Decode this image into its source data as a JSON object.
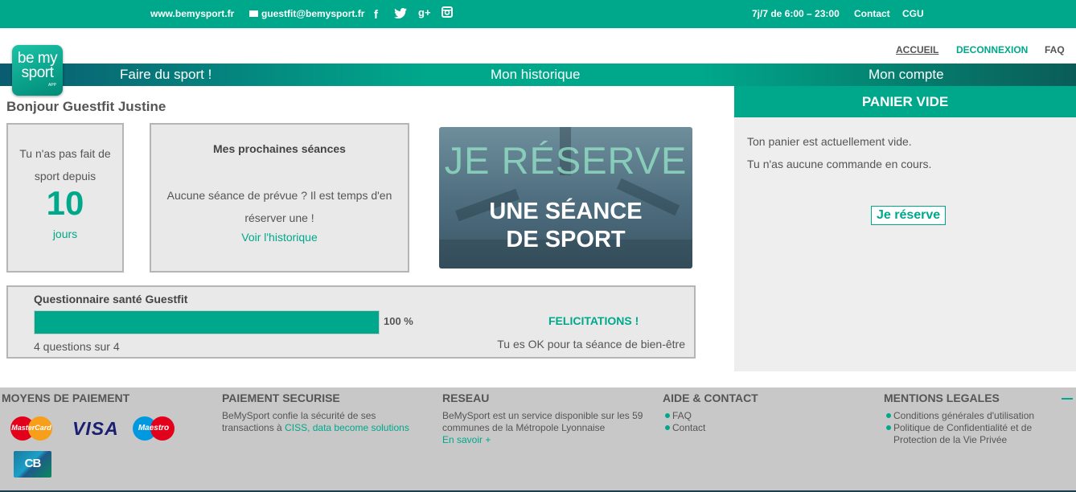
{
  "topbar": {
    "site": "www.bemysport.fr",
    "email": "guestfit@bemysport.fr",
    "social": [
      "f",
      "t",
      "g+",
      "ig"
    ],
    "hours": "7j/7 de 6:00 – 23:00",
    "contact": "Contact",
    "cgu": "CGU"
  },
  "header": {
    "links": [
      "ACCUEIL",
      "DECONNEXION",
      "FAQ"
    ]
  },
  "logo": {
    "line1": "be my",
    "line2": "sport",
    "line3": "APP"
  },
  "nav": {
    "items": [
      "Faire du sport !",
      "Mon historique",
      "Mon compte"
    ]
  },
  "greeting": "Bonjour Guestfit Justine",
  "inactivity": {
    "line": "Tu n'as pas fait de sport depuis",
    "value": "10",
    "unit": "jours"
  },
  "sessions": {
    "title": "Mes prochaines séances",
    "message": "Aucune séance de prévue ? Il est temps d'en réserver une !",
    "link": "Voir l'historique"
  },
  "promo": {
    "big": "JE RÉSERVE",
    "line1": "UNE SÉANCE",
    "line2": "DE SPORT"
  },
  "questionnaire": {
    "title": "Questionnaire santé Guestfit",
    "progress": 1.0,
    "percent_label": "100 %",
    "count": "4 questions sur 4",
    "congrats": "FELICITATIONS !",
    "ok": "Tu es OK pour ta séance de bien-être"
  },
  "cart": {
    "title": "PANIER VIDE",
    "line1": "Ton panier est actuellement vide.",
    "line2": "Tu n'as aucune commande en cours.",
    "button": "Je réserve"
  },
  "footer": {
    "payment_title": "MOYENS DE PAIEMENT",
    "cards": {
      "mastercard": "MasterCard",
      "visa": "VISA",
      "maestro": "Maestro",
      "cb": "CB"
    },
    "secure_title": "PAIEMENT SECURISE",
    "secure_text": "BeMySport confie la sécurité de ses transactions à",
    "secure_link": "CISS, data become solutions",
    "network_title": "RESEAU",
    "network_text": "BeMySport est un service disponible sur les 59 communes de la Métropole Lyonnaise",
    "network_link": "En savoir +",
    "help_title": "AIDE & CONTACT",
    "help_items": [
      "FAQ",
      "Contact"
    ],
    "legal_title": "MENTIONS LEGALES",
    "legal_items": [
      "Conditions générales d'utilisation",
      "Politique de Confidentialité et de Protection de la Vie Privée"
    ]
  },
  "colors": {
    "accent": "#00a88b",
    "dark_navy": "#1b3d54"
  }
}
